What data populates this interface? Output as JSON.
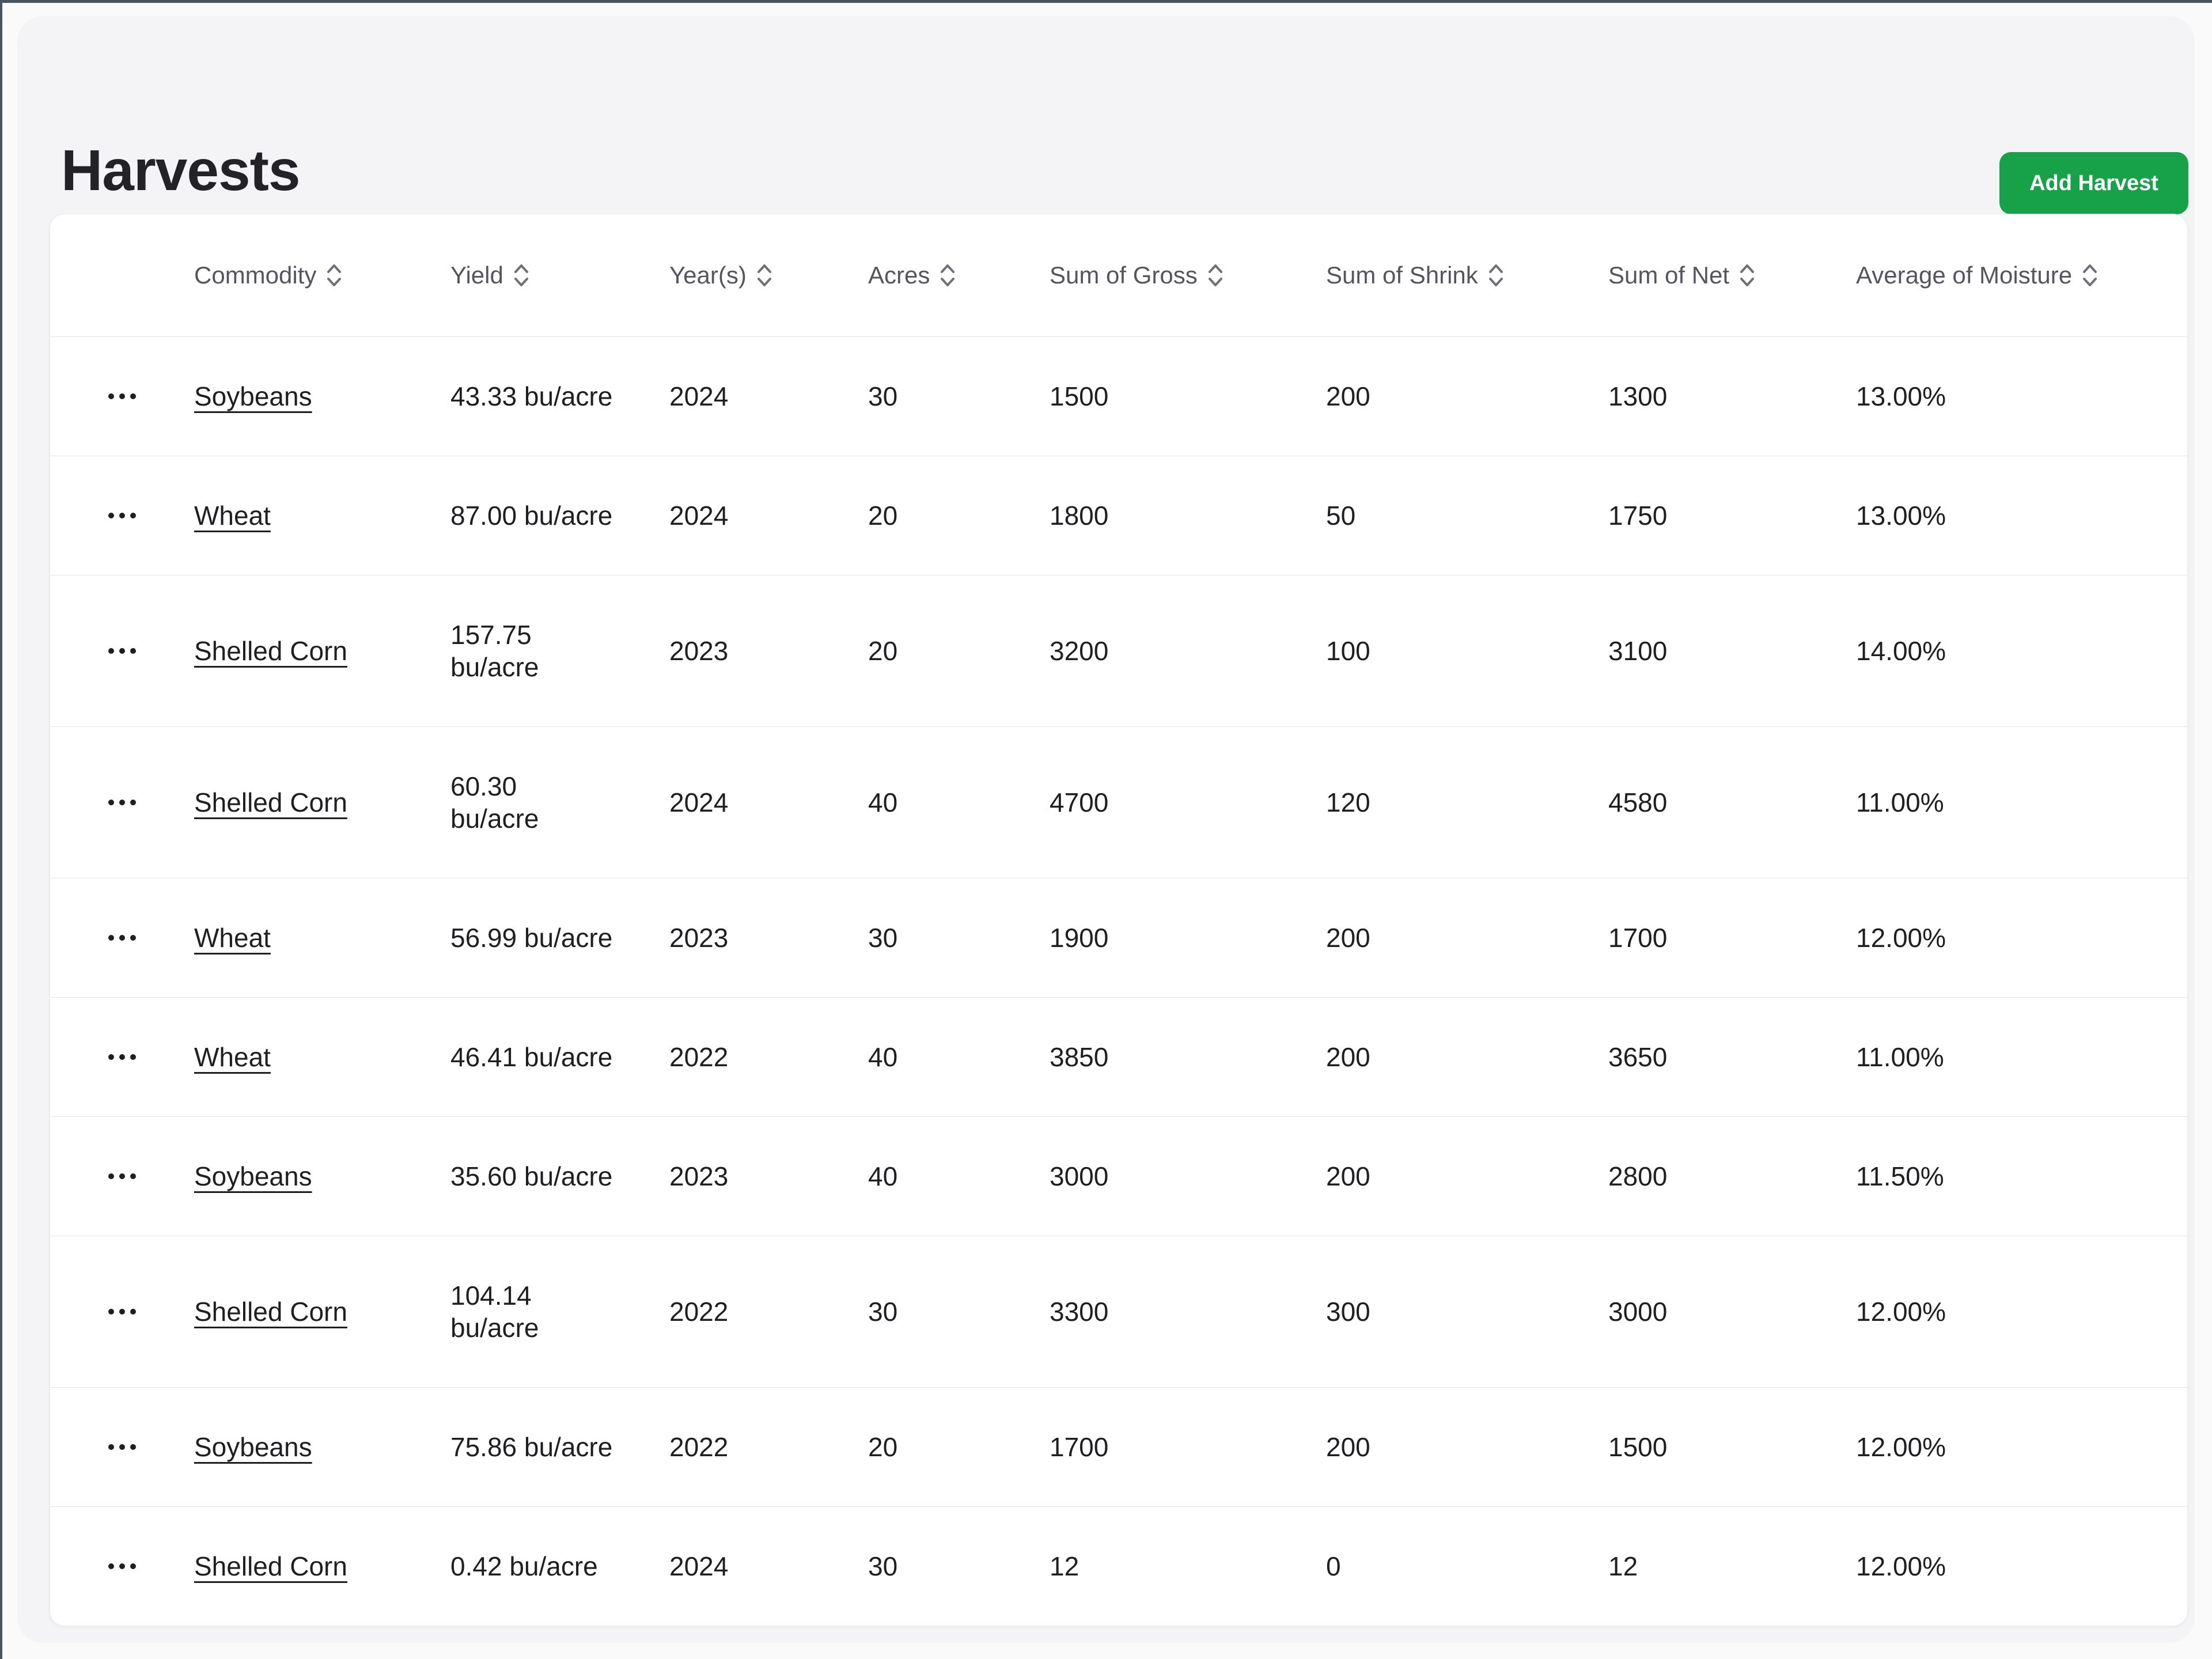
{
  "page": {
    "title": "Harvests"
  },
  "toolbar": {
    "add_button_label": "Add Harvest"
  },
  "colors": {
    "accent_green": "#17a24a",
    "page_background": "#fafafa",
    "panel_background": "#f4f4f6",
    "card_background": "#ffffff",
    "row_border": "#e4e4e7",
    "header_text": "#55555e",
    "cell_text": "#1f1f23",
    "frame_edge": "#47545e"
  },
  "icons": {
    "sort": "sort-chevrons-icon",
    "row_menu": "ellipsis-menu-icon"
  },
  "table": {
    "columns": [
      {
        "key": "commodity",
        "label": "Commodity",
        "sortable": true
      },
      {
        "key": "yield",
        "label": "Yield",
        "sortable": true
      },
      {
        "key": "years",
        "label": "Year(s)",
        "sortable": true
      },
      {
        "key": "acres",
        "label": "Acres",
        "sortable": true
      },
      {
        "key": "gross",
        "label": "Sum of Gross",
        "sortable": true
      },
      {
        "key": "shrink",
        "label": "Sum of Shrink",
        "sortable": true
      },
      {
        "key": "net",
        "label": "Sum of Net",
        "sortable": true
      },
      {
        "key": "moisture",
        "label": "Average of Moisture",
        "sortable": true
      }
    ],
    "rows": [
      {
        "commodity": "Soybeans",
        "yield_value": "43.33",
        "yield_unit": "bu/acre",
        "yield_two_lines": false,
        "years": "2024",
        "acres": "30",
        "gross": "1500",
        "shrink": "200",
        "net": "1300",
        "moisture": "13.00%"
      },
      {
        "commodity": "Wheat",
        "yield_value": "87.00",
        "yield_unit": "bu/acre",
        "yield_two_lines": false,
        "years": "2024",
        "acres": "20",
        "gross": "1800",
        "shrink": "50",
        "net": "1750",
        "moisture": "13.00%"
      },
      {
        "commodity": "Shelled Corn",
        "yield_value": "157.75",
        "yield_unit": "bu/acre",
        "yield_two_lines": true,
        "years": "2023",
        "acres": "20",
        "gross": "3200",
        "shrink": "100",
        "net": "3100",
        "moisture": "14.00%"
      },
      {
        "commodity": "Shelled Corn",
        "yield_value": "60.30",
        "yield_unit": "bu/acre",
        "yield_two_lines": true,
        "years": "2024",
        "acres": "40",
        "gross": "4700",
        "shrink": "120",
        "net": "4580",
        "moisture": "11.00%"
      },
      {
        "commodity": "Wheat",
        "yield_value": "56.99",
        "yield_unit": "bu/acre",
        "yield_two_lines": false,
        "years": "2023",
        "acres": "30",
        "gross": "1900",
        "shrink": "200",
        "net": "1700",
        "moisture": "12.00%"
      },
      {
        "commodity": "Wheat",
        "yield_value": "46.41",
        "yield_unit": "bu/acre",
        "yield_two_lines": false,
        "years": "2022",
        "acres": "40",
        "gross": "3850",
        "shrink": "200",
        "net": "3650",
        "moisture": "11.00%"
      },
      {
        "commodity": "Soybeans",
        "yield_value": "35.60",
        "yield_unit": "bu/acre",
        "yield_two_lines": false,
        "years": "2023",
        "acres": "40",
        "gross": "3000",
        "shrink": "200",
        "net": "2800",
        "moisture": "11.50%"
      },
      {
        "commodity": "Shelled Corn",
        "yield_value": "104.14",
        "yield_unit": "bu/acre",
        "yield_two_lines": true,
        "years": "2022",
        "acres": "30",
        "gross": "3300",
        "shrink": "300",
        "net": "3000",
        "moisture": "12.00%"
      },
      {
        "commodity": "Soybeans",
        "yield_value": "75.86",
        "yield_unit": "bu/acre",
        "yield_two_lines": false,
        "years": "2022",
        "acres": "20",
        "gross": "1700",
        "shrink": "200",
        "net": "1500",
        "moisture": "12.00%"
      },
      {
        "commodity": "Shelled Corn",
        "yield_value": "0.42",
        "yield_unit": "bu/acre",
        "yield_two_lines": false,
        "years": "2024",
        "acres": "30",
        "gross": "12",
        "shrink": "0",
        "net": "12",
        "moisture": "12.00%"
      }
    ]
  }
}
